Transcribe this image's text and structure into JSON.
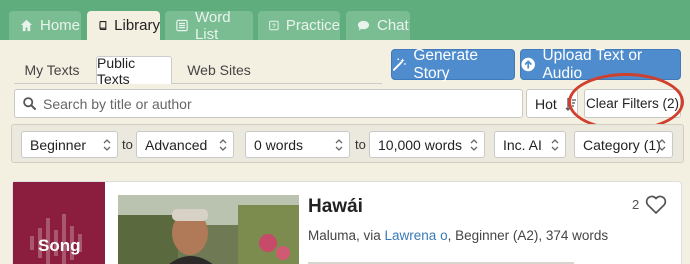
{
  "nav": {
    "tabs": [
      {
        "label": "Home",
        "icon": "home-icon"
      },
      {
        "label": "Library",
        "icon": "book-icon"
      },
      {
        "label": "Word List",
        "icon": "list-icon"
      },
      {
        "label": "Practice",
        "icon": "question-icon"
      },
      {
        "label": "Chat",
        "icon": "chat-icon"
      }
    ],
    "active": "Library"
  },
  "subtabs": [
    "My Texts",
    "Public Texts",
    "Web Sites"
  ],
  "actions": {
    "generate_story": "Generate Story",
    "upload": "Upload Text or Audio"
  },
  "search": {
    "placeholder": "Search by title or author"
  },
  "sort": {
    "label": "Hot"
  },
  "clear_filters": "Clear Filters (2)",
  "filters": {
    "level_from": "Beginner",
    "to_1": "to",
    "level_to": "Advanced",
    "words_from": "0 words",
    "to_2": "to",
    "words_to": "10,000 words",
    "ai": "Inc. AI",
    "category": "Category (1)"
  },
  "card": {
    "badge": "Song",
    "title": "Hawái",
    "meta_prefix": "Maluma, via ",
    "author_link": "Lawrena o",
    "meta_suffix": ", Beginner (A2), 374 words",
    "likes": "2"
  },
  "colors": {
    "nav_bg": "#5fac7c",
    "page_bg": "#f3f0e2",
    "accent_blue": "#4e8ccd",
    "song_badge": "#8b1e3f",
    "annotation_red": "#d0402d"
  }
}
